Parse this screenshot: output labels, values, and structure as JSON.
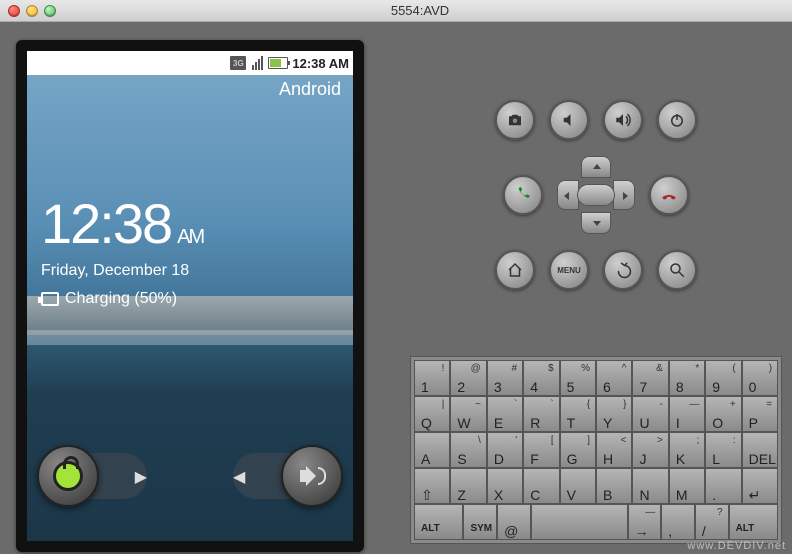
{
  "window": {
    "title": "5554:AVD"
  },
  "statusbar": {
    "network_type": "3G",
    "time": "12:38 AM"
  },
  "lockscreen": {
    "carrier": "Android",
    "time": "12:38",
    "ampm": "AM",
    "date": "Friday, December 18",
    "charge": "Charging (50%)"
  },
  "hw_buttons": {
    "row1": [
      "camera-icon",
      "volume-down-icon",
      "volume-up-icon",
      "power-icon"
    ],
    "call": "call-icon",
    "end": "end-icon",
    "row3": [
      "home-icon",
      "menu-text",
      "back-icon",
      "search-icon"
    ],
    "menu_label": "MENU"
  },
  "keyboard": {
    "rows": [
      [
        {
          "m": "1",
          "s": "!"
        },
        {
          "m": "2",
          "s": "@"
        },
        {
          "m": "3",
          "s": "#"
        },
        {
          "m": "4",
          "s": "$"
        },
        {
          "m": "5",
          "s": "%"
        },
        {
          "m": "6",
          "s": "^"
        },
        {
          "m": "7",
          "s": "&"
        },
        {
          "m": "8",
          "s": "*"
        },
        {
          "m": "9",
          "s": "("
        },
        {
          "m": "0",
          "s": ")"
        }
      ],
      [
        {
          "m": "Q",
          "s": "|"
        },
        {
          "m": "W",
          "s": "~"
        },
        {
          "m": "E",
          "s": "`"
        },
        {
          "m": "R",
          "s": "`"
        },
        {
          "m": "T",
          "s": "{"
        },
        {
          "m": "Y",
          "s": "}"
        },
        {
          "m": "U",
          "s": "-"
        },
        {
          "m": "I",
          "s": "—"
        },
        {
          "m": "O",
          "s": "+"
        },
        {
          "m": "P",
          "s": "="
        }
      ],
      [
        {
          "m": "A",
          "s": ""
        },
        {
          "m": "S",
          "s": "\\"
        },
        {
          "m": "D",
          "s": "'"
        },
        {
          "m": "F",
          "s": "["
        },
        {
          "m": "G",
          "s": "]"
        },
        {
          "m": "H",
          "s": "<"
        },
        {
          "m": "J",
          "s": ">"
        },
        {
          "m": "K",
          "s": ";"
        },
        {
          "m": "L",
          "s": ":"
        },
        {
          "m": "DEL",
          "s": "",
          "icon": "delete-icon"
        }
      ],
      [
        {
          "m": "⇧",
          "s": "",
          "icon": "shift-icon"
        },
        {
          "m": "Z",
          "s": ""
        },
        {
          "m": "X",
          "s": ""
        },
        {
          "m": "C",
          "s": ""
        },
        {
          "m": "V",
          "s": ""
        },
        {
          "m": "B",
          "s": ""
        },
        {
          "m": "N",
          "s": ""
        },
        {
          "m": "M",
          "s": ""
        },
        {
          "m": ".",
          "s": ""
        },
        {
          "m": "↵",
          "s": "",
          "icon": "enter-icon"
        }
      ],
      [
        {
          "m": "ALT",
          "s": "",
          "cls": "alt wide"
        },
        {
          "m": "SYM",
          "s": "",
          "cls": "alt"
        },
        {
          "m": "@",
          "s": ""
        },
        {
          "m": "",
          "s": "",
          "cls": "space",
          "icon": "space-icon"
        },
        {
          "m": "→",
          "s": "—",
          "icon": "arrow-right-icon"
        },
        {
          "m": ",",
          "s": ""
        },
        {
          "m": "/",
          "s": "?"
        },
        {
          "m": "ALT",
          "s": "",
          "cls": "alt wide"
        }
      ]
    ]
  },
  "watermark": "www.DEVDIV.net"
}
